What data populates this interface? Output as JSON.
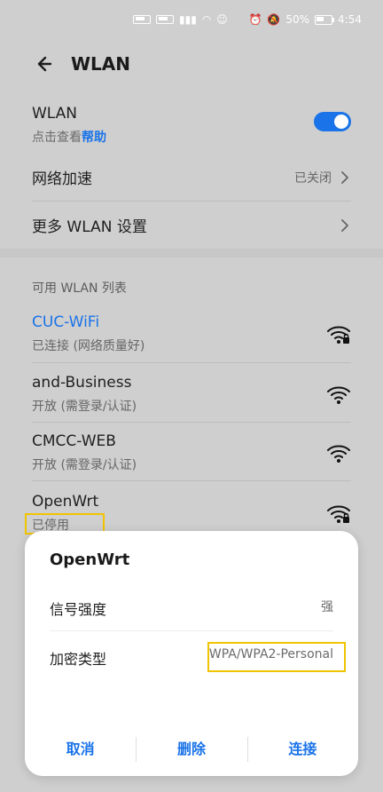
{
  "status_bar": {
    "battery": "50%",
    "time": "4:54"
  },
  "header": {
    "title": "WLAN"
  },
  "settings": {
    "wlan_label": "WLAN",
    "wlan_hint_prefix": "点击查看",
    "wlan_hint_link": "帮助",
    "network_boost_label": "网络加速",
    "network_boost_value": "已关闭",
    "more_settings_label": "更多 WLAN 设置"
  },
  "networks_section": {
    "title": "可用 WLAN 列表",
    "items": [
      {
        "name": "CUC-WiFi",
        "status": "已连接 (网络质量好)",
        "locked": true
      },
      {
        "name": "and-Business",
        "status": "开放 (需登录/认证)",
        "locked": false
      },
      {
        "name": "CMCC-WEB",
        "status": "开放 (需登录/认证)",
        "locked": false
      },
      {
        "name": "OpenWrt",
        "status": "已停用",
        "locked": true
      }
    ]
  },
  "dialog": {
    "title": "OpenWrt",
    "signal_label": "信号强度",
    "signal_value": "强",
    "encryption_label": "加密类型",
    "encryption_value": "WPA/WPA2-Personal",
    "cancel": "取消",
    "delete": "删除",
    "connect": "连接"
  },
  "colors": {
    "accent": "#1a73e8",
    "highlight": "#f0c400"
  }
}
